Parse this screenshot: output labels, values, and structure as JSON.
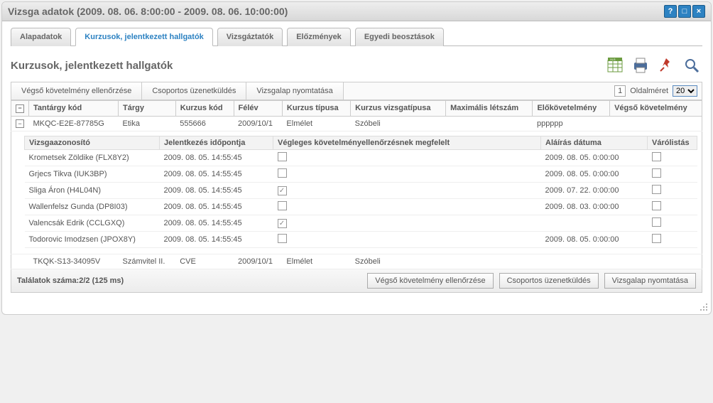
{
  "window": {
    "title": "Vizsga adatok (2009. 08. 06. 8:00:00 - 2009. 08. 06. 10:00:00)"
  },
  "tabs": [
    {
      "label": "Alapadatok"
    },
    {
      "label": "Kurzusok, jelentkezett hallgatók"
    },
    {
      "label": "Vizsgáztatók"
    },
    {
      "label": "Előzmények"
    },
    {
      "label": "Egyedi beosztások"
    }
  ],
  "section_title": "Kurzusok, jelentkezett hallgatók",
  "sub_tabs": [
    {
      "label": "Végső követelmény ellenőrzése"
    },
    {
      "label": "Csoportos üzenetküldés"
    },
    {
      "label": "Vizsgalap nyomtatása"
    }
  ],
  "pager": {
    "page": "1",
    "size_label": "Oldalméret",
    "size_value": "20"
  },
  "grid": {
    "headers": {
      "h1": "Tantárgy kód",
      "h2": "Tárgy",
      "h3": "Kurzus kód",
      "h4": "Félév",
      "h5": "Kurzus típusa",
      "h6": "Kurzus vizsgatípusa",
      "h7": "Maximális létszám",
      "h8": "Előkövetelmény",
      "h9": "Végső követelmény"
    },
    "row1": {
      "c1": "MKQC-E2E-87785G",
      "c2": "Etika",
      "c3": "555666",
      "c4": "2009/10/1",
      "c5": "Elmélet",
      "c6": "Szóbeli",
      "c7": "",
      "c8": "pppppp",
      "c9": ""
    },
    "row2": {
      "c1": "TKQK-S13-34095V",
      "c2": "Számvitel II.",
      "c3": "CVE",
      "c4": "2009/10/1",
      "c5": "Elmélet",
      "c6": "Szóbeli",
      "c7": "",
      "c8": "",
      "c9": ""
    }
  },
  "subgrid": {
    "headers": {
      "h1": "Vizsgaazonosító",
      "h2": "Jelentkezés időpontja",
      "h3": "Végleges követelményellenőrzésnek megfelelt",
      "h4": "Aláírás dátuma",
      "h5": "Várólistás"
    },
    "rows": [
      {
        "name": "Krometsek Zöldike (FLX8Y2)",
        "date": "2009. 08. 05. 14:55:45",
        "chk": false,
        "sig": "2009. 08. 05. 0:00:00",
        "wait": false
      },
      {
        "name": "Grjecs Tikva (IUK3BP)",
        "date": "2009. 08. 05. 14:55:45",
        "chk": false,
        "sig": "2009. 08. 05. 0:00:00",
        "wait": false
      },
      {
        "name": "Sliga Áron (H4L04N)",
        "date": "2009. 08. 05. 14:55:45",
        "chk": true,
        "sig": "2009. 07. 22. 0:00:00",
        "wait": false
      },
      {
        "name": "Wallenfelsz Gunda (DP8I03)",
        "date": "2009. 08. 05. 14:55:45",
        "chk": false,
        "sig": "2009. 08. 03. 0:00:00",
        "wait": false
      },
      {
        "name": "Valencsák Edrik (CCLGXQ)",
        "date": "2009. 08. 05. 14:55:45",
        "chk": true,
        "sig": "",
        "wait": false
      },
      {
        "name": "Todorovic Imodzsen (JPOX8Y)",
        "date": "2009. 08. 05. 14:55:45",
        "chk": false,
        "sig": "2009. 08. 05. 0:00:00",
        "wait": false
      }
    ]
  },
  "footer": {
    "count": "Találatok száma:2/2 (125 ms)",
    "btn1": "Végső követelmény ellenőrzése",
    "btn2": "Csoportos üzenetküldés",
    "btn3": "Vizsgalap nyomtatása"
  }
}
